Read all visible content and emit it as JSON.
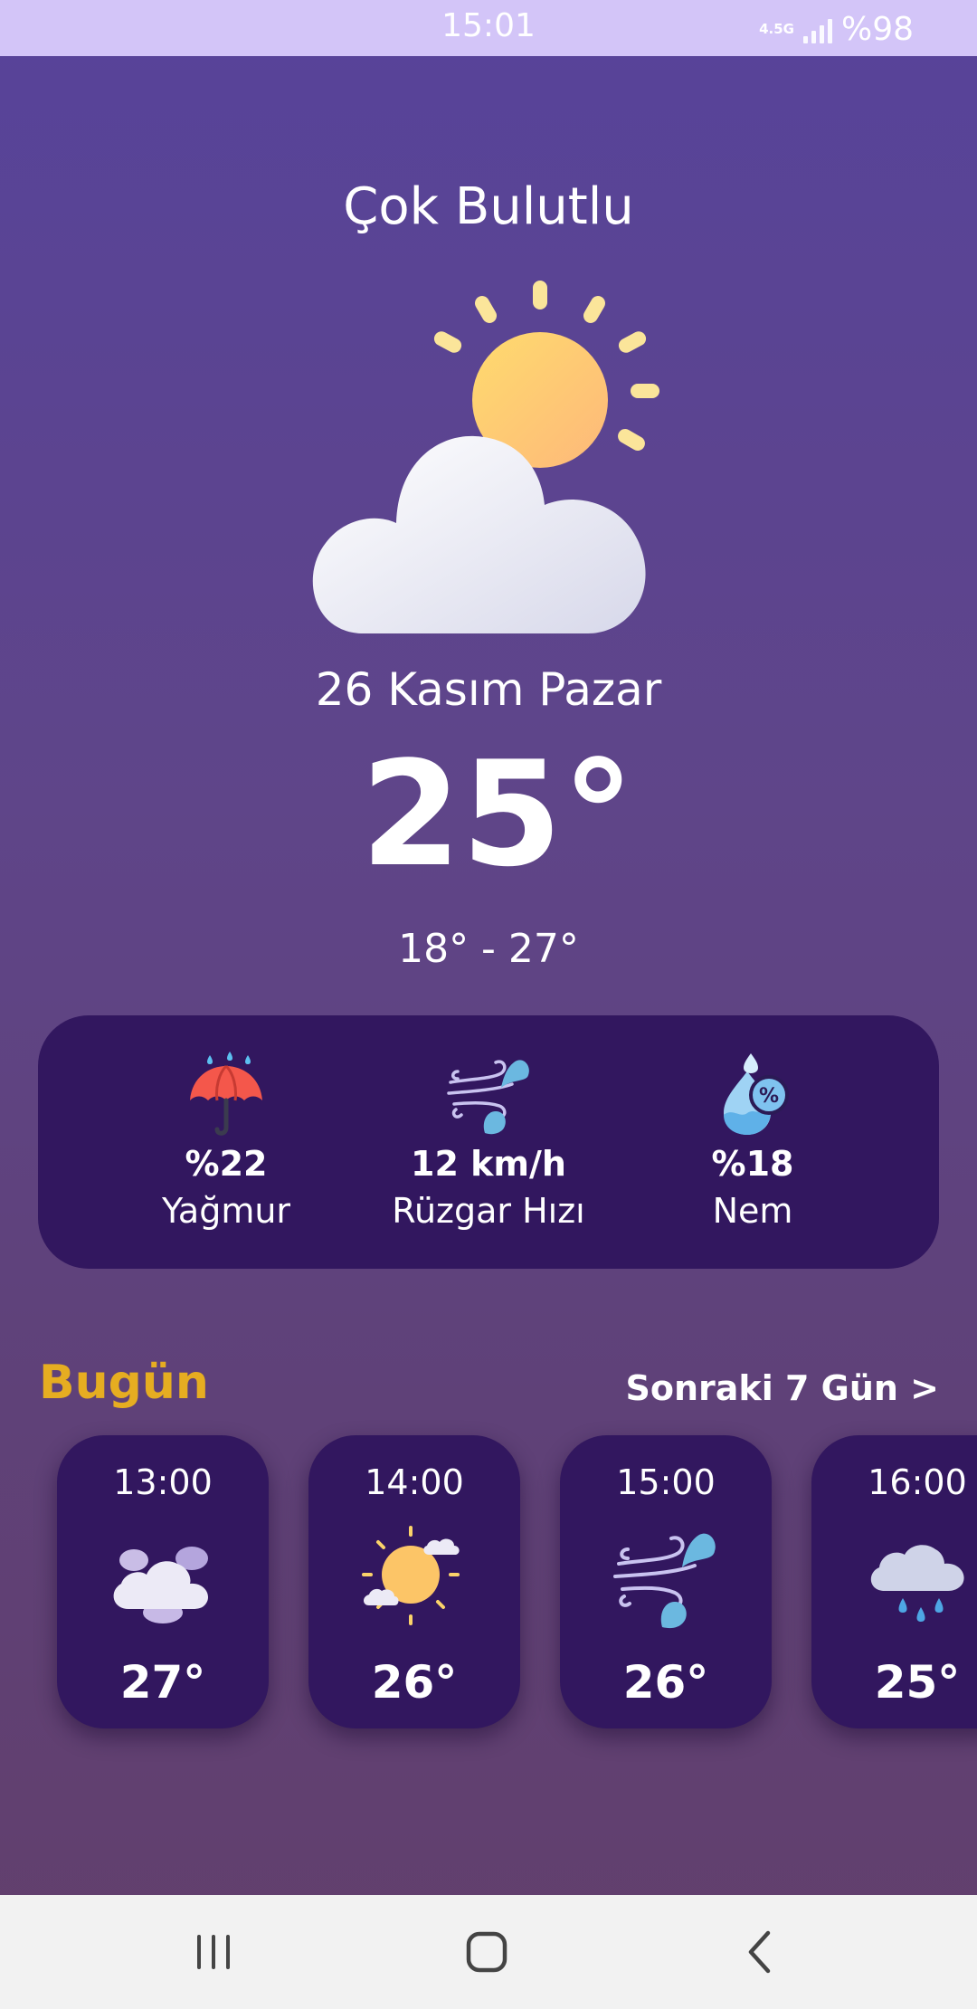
{
  "status_bar": {
    "time": "15:01",
    "network": "4.5G",
    "battery": "%98",
    "icons": [
      "network-type-icon",
      "signal-icon"
    ]
  },
  "weather": {
    "condition": "Çok Bulutlu",
    "icon": "sun-behind-cloud-icon",
    "date": "26 Kasım Pazar",
    "temperature": "25°",
    "range": "18° - 27°"
  },
  "stats": [
    {
      "icon": "umbrella-icon",
      "value": "%22",
      "label": "Yağmur"
    },
    {
      "icon": "wind-icon",
      "value": "12 km/h",
      "label": "Rüzgar Hızı"
    },
    {
      "icon": "humidity-icon",
      "value": "%18",
      "label": "Nem"
    }
  ],
  "today": {
    "title": "Bugün",
    "next_link": "Sonraki 7 Gün >",
    "hours": [
      {
        "time": "13:00",
        "icon": "clouds-icon",
        "temp": "27°"
      },
      {
        "time": "14:00",
        "icon": "sun-cloud-icon",
        "temp": "26°"
      },
      {
        "time": "15:00",
        "icon": "wind-icon",
        "temp": "26°"
      },
      {
        "time": "16:00",
        "icon": "rain-cloud-icon",
        "temp": "25°"
      }
    ]
  },
  "nav": {
    "icons": [
      "recent-apps-icon",
      "home-icon",
      "back-icon"
    ]
  },
  "colors": {
    "accent": "#e6ad21",
    "card": "#32175f",
    "status_bar": "#d3c5f8"
  }
}
